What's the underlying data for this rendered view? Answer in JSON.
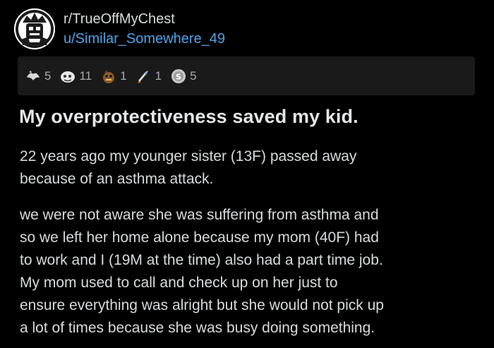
{
  "post": {
    "subreddit": "r/TrueOffMyChest",
    "username": "u/Similar_Somewhere_49",
    "awards": [
      {
        "icon": "wholesome-award-icon",
        "count": "5"
      },
      {
        "icon": "bravo-award-icon",
        "count": "11"
      },
      {
        "icon": "helpful-award-icon",
        "count": "1"
      },
      {
        "icon": "rocket-award-icon",
        "count": "1"
      },
      {
        "icon": "silver-award-icon",
        "count": "5"
      }
    ],
    "title": "My overprotectiveness saved my kid.",
    "paragraph1_lines": [
      "22 years ago my younger sister (13F) passed away",
      "because of an asthma attack."
    ],
    "paragraph2_lines": [
      "we were not aware she was suffering from asthma and",
      "so we left her home alone because my mom (40F) had",
      "to work and I (19M at the time) also had a part time job.",
      "My mom used to call and check up on her just to",
      "ensure everything was alright but she would not pick up",
      "a lot of times because she was busy doing something."
    ]
  },
  "colors": {
    "background": "#000000",
    "text": "#d7dadc",
    "username": "#4fa3e8",
    "awards_bar": "#1a1a1b"
  }
}
